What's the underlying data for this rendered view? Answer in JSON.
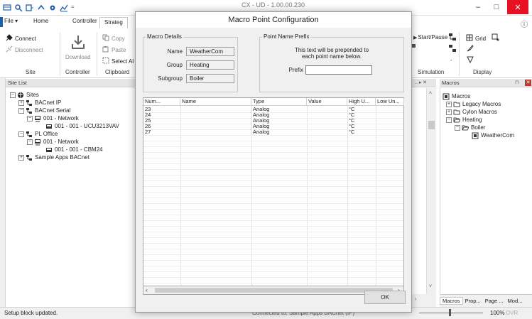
{
  "app": {
    "title": "CX - UD - 1.00.00.230",
    "window_controls": [
      "–",
      "□",
      "✕"
    ],
    "help": "ⓘ"
  },
  "tabs": [
    {
      "label": "File",
      "dropdown": "▾"
    },
    {
      "label": "Home"
    },
    {
      "label": "Controller"
    },
    {
      "label": "Strateg"
    }
  ],
  "ribbon": {
    "site": {
      "connect": "Connect",
      "disconnect": "Disconnect",
      "label": "Site"
    },
    "controller": {
      "download": "Download",
      "label": "Controller"
    },
    "clipboard": {
      "copy": "Copy",
      "paste": "Paste",
      "select_all": "Select Al",
      "label": "Clipboard"
    },
    "simulation": {
      "start_pause": "Start/Pause",
      "dash": "-",
      "label": "Simulation"
    },
    "display": {
      "grid": "Grid",
      "label": "Display"
    }
  },
  "site_list": {
    "header": "Site List",
    "items": [
      {
        "label": "Sites"
      },
      {
        "label": "BACnet IP"
      },
      {
        "label": "BACnet Serial"
      },
      {
        "label": "001 - Network"
      },
      {
        "label": "001 - 001 - UCU3213VAV"
      },
      {
        "label": "PL Office"
      },
      {
        "label": "001 - Network"
      },
      {
        "label": "001 - 001 - CBM24"
      },
      {
        "label": "Sample Apps BACnet"
      }
    ]
  },
  "macros_panel": {
    "header": "Macros",
    "items": [
      {
        "label": "Macros"
      },
      {
        "label": "Legacy Macros"
      },
      {
        "label": "Cylon Macros"
      },
      {
        "label": "Heating"
      },
      {
        "label": "Boiler"
      },
      {
        "label": "WeatherCom"
      }
    ],
    "bottom_tabs": [
      "Macros",
      "Prop...",
      "Page ...",
      "Mod..."
    ]
  },
  "status": {
    "message": "Setup block updated.",
    "center": "Connected to: Sample Apps BACnet (IP)",
    "zoom": "100%",
    "ovr": "OVR"
  },
  "dialog": {
    "title": "Macro Point Configuration",
    "details": {
      "legend": "Macro Details",
      "name_label": "Name",
      "name_value": "WeatherCom",
      "group_label": "Group",
      "group_value": "Heating",
      "subgroup_label": "Subgroup",
      "subgroup_value": "Boiler"
    },
    "prefix": {
      "legend": "Point Name Prefix",
      "help_line1": "This text will be prepended to",
      "help_line2": "each point name below.",
      "label": "Prefix",
      "value": ""
    },
    "table": {
      "columns": [
        "Num...",
        "Name",
        "Type",
        "Value",
        "High U...",
        "Low Un..."
      ],
      "rows": [
        {
          "num": "23",
          "name": "",
          "type": "Analog",
          "value": "",
          "high": "°C",
          "low": ""
        },
        {
          "num": "24",
          "name": "",
          "type": "Analog",
          "value": "",
          "high": "°C",
          "low": ""
        },
        {
          "num": "25",
          "name": "",
          "type": "Analog",
          "value": "",
          "high": "°C",
          "low": ""
        },
        {
          "num": "26",
          "name": "",
          "type": "Analog",
          "value": "",
          "high": "°C",
          "low": ""
        },
        {
          "num": "27",
          "name": "",
          "type": "Analog",
          "value": "",
          "high": "°C",
          "low": ""
        }
      ]
    },
    "ok_label": "OK"
  },
  "colors": {
    "accent_red": "#c0392b",
    "folder_outline": "#444444",
    "dialog_bg": "#f0f0f0"
  }
}
